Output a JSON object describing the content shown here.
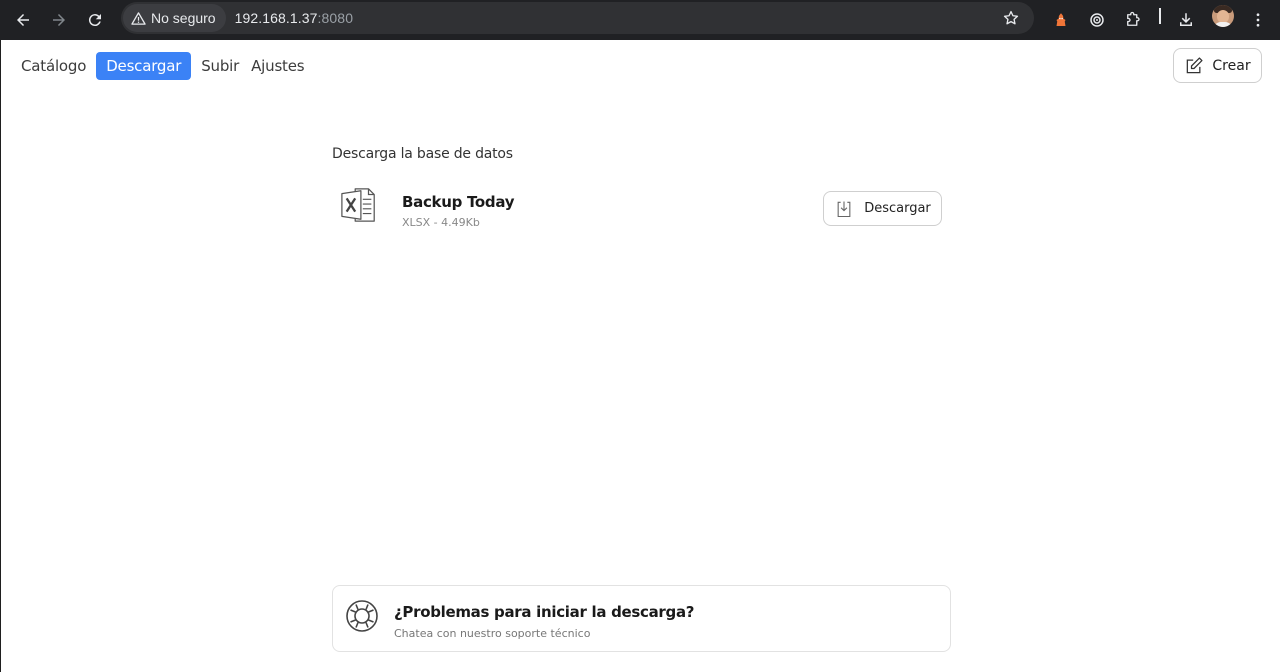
{
  "browser": {
    "security_label": "No seguro",
    "url_host": "192.168.1.37",
    "url_port": ":8080",
    "icons": [
      "back-icon",
      "forward-icon",
      "reload-icon",
      "warning-icon",
      "star-icon",
      "extension-fox-icon",
      "extension-target-icon",
      "extensions-puzzle-icon",
      "download-icon",
      "avatar",
      "menu-icon"
    ]
  },
  "nav": {
    "tabs": [
      {
        "label": "Catálogo",
        "active": false
      },
      {
        "label": "Descargar",
        "active": true
      },
      {
        "label": "Subir",
        "active": false
      },
      {
        "label": "Ajustes",
        "active": false
      }
    ],
    "create_label": "Crear"
  },
  "download": {
    "section_title": "Descarga la base de datos",
    "file": {
      "name": "Backup Today",
      "meta": "XLSX - 4.49Kb",
      "icon": "excel-file-icon"
    },
    "button_label": "Descargar"
  },
  "help": {
    "title": "¿Problemas para iniciar la descarga?",
    "subtitle": "Chatea con nuestro soporte técnico",
    "icon": "lifebuoy-icon"
  },
  "colors": {
    "accent": "#3b82f6",
    "chrome_bg": "#202124",
    "omnibox_bg": "#303134"
  }
}
